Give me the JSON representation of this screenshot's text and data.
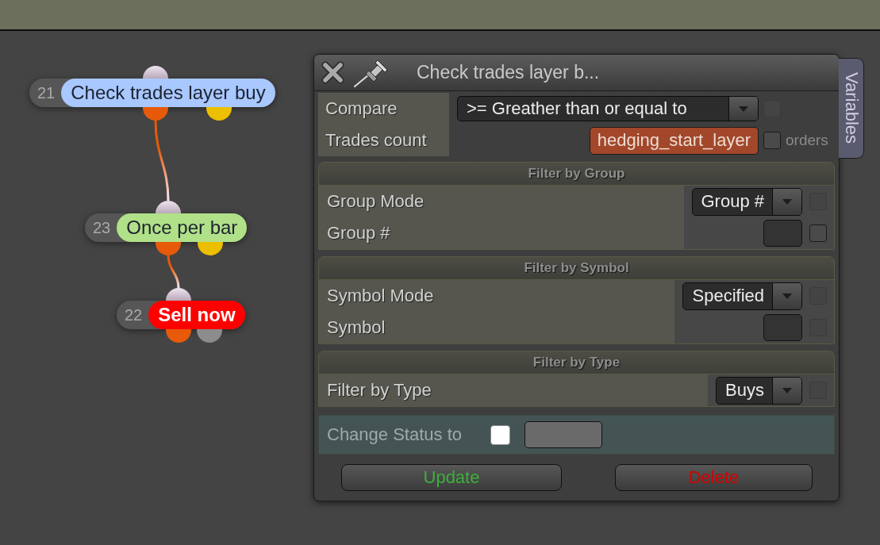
{
  "nodes": [
    {
      "number": "21",
      "label": "Check trades layer buy",
      "color": "#a8c8ff",
      "outputs": [
        {
          "color": "#e65a0a",
          "connected": true
        },
        {
          "color": "#ecc000",
          "connected": false
        }
      ]
    },
    {
      "number": "23",
      "label": "Once per bar",
      "color": "#b0e088",
      "outputs": [
        {
          "color": "#e65a0a",
          "connected": true
        },
        {
          "color": "#ecc000",
          "connected": false
        }
      ]
    },
    {
      "number": "22",
      "label": "Sell now",
      "color": "#ff0000",
      "outputs": [
        {
          "color": "#e65a0a",
          "connected": false
        },
        {
          "color": "#8c8c8c",
          "connected": false
        }
      ]
    }
  ],
  "dialog": {
    "title": "Check trades layer b...",
    "side_tab": "Variables",
    "fields": [
      {
        "kind": "dropdown",
        "label": "Compare",
        "value": ">= Greather than or equal to",
        "checkbox": {
          "checked": false,
          "disabled": true
        }
      },
      {
        "kind": "variable",
        "label": "Trades count",
        "value": "hedging_start_layer",
        "checkbox": {
          "checked": false,
          "disabled": false
        },
        "suffix": "orders"
      }
    ],
    "sections": [
      {
        "title": "Filter by Group",
        "rows": [
          {
            "kind": "dropdown",
            "label": "Group Mode",
            "value": "Group #",
            "checkbox": {
              "checked": false,
              "disabled": true
            }
          },
          {
            "kind": "input",
            "label": "Group #",
            "checkbox": {
              "checked": false,
              "disabled": false
            }
          }
        ]
      },
      {
        "title": "Filter by Symbol",
        "rows": [
          {
            "kind": "dropdown",
            "label": "Symbol Mode",
            "value": "Specified",
            "checkbox": {
              "checked": false,
              "disabled": true
            }
          },
          {
            "kind": "input",
            "label": "Symbol",
            "checkbox": {
              "checked": false,
              "disabled": true
            }
          }
        ]
      },
      {
        "title": "Filter by Type",
        "rows": [
          {
            "kind": "dropdown",
            "label": "Filter by Type",
            "value": "Buys",
            "checkbox": {
              "checked": false,
              "disabled": true
            }
          }
        ]
      }
    ],
    "status_row": {
      "label": "Change Status to",
      "checkbox": {
        "checked": false
      }
    },
    "buttons": [
      {
        "label": "Update",
        "color": "#3cb03c"
      },
      {
        "label": "Delete",
        "color": "#d40000"
      }
    ]
  }
}
